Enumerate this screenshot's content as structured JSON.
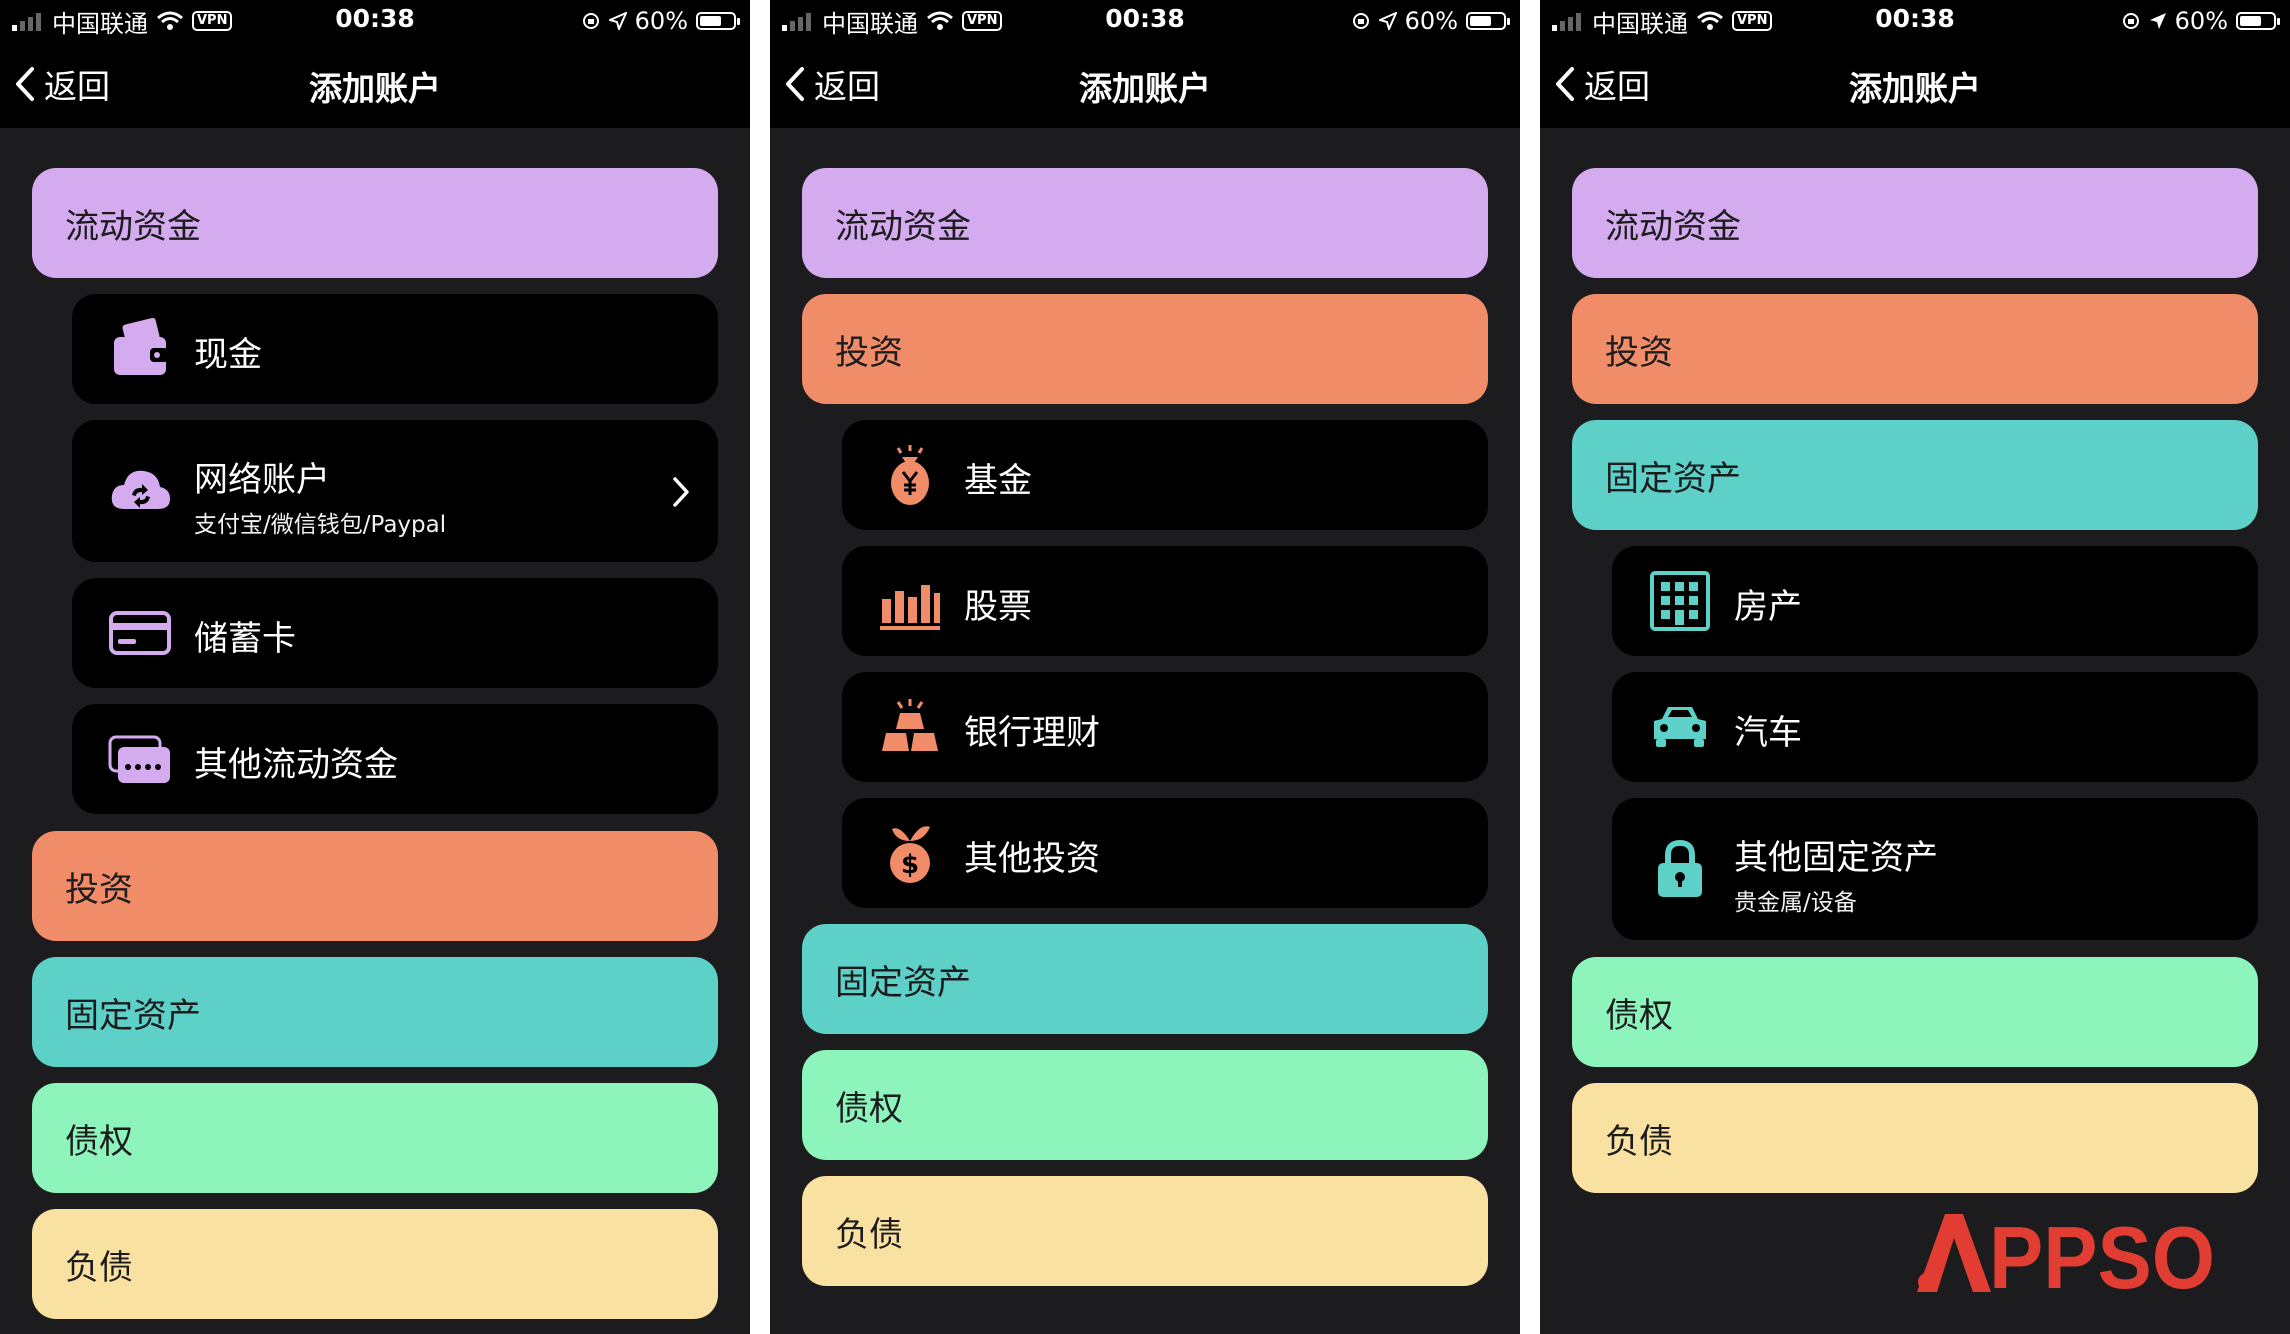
{
  "statusbar": {
    "carrier": "中国联通",
    "vpn": "VPN",
    "time": "00:38",
    "battery": "60%",
    "battery_level": 0.6
  },
  "nav": {
    "back_label": "返回",
    "title": "添加账户"
  },
  "categories": {
    "liquid": "流动资金",
    "invest": "投资",
    "fixed": "固定资产",
    "claims": "债权",
    "debt": "负债"
  },
  "liquid_items": {
    "cash": "现金",
    "online": "网络账户",
    "online_sub": "支付宝/微信钱包/Paypal",
    "debit": "储蓄卡",
    "other": "其他流动资金"
  },
  "invest_items": {
    "fund": "基金",
    "stock": "股票",
    "bank": "银行理财",
    "other": "其他投资"
  },
  "fixed_items": {
    "house": "房产",
    "car": "汽车",
    "other": "其他固定资产",
    "other_sub": "贵金属/设备"
  },
  "colors": {
    "liquid": "#d4abef",
    "invest": "#f08c68",
    "fixed": "#5dd0c8",
    "claims": "#8df4bc",
    "debt": "#f9e2a1",
    "logo": "#e23d33"
  },
  "logo": "APPSO"
}
